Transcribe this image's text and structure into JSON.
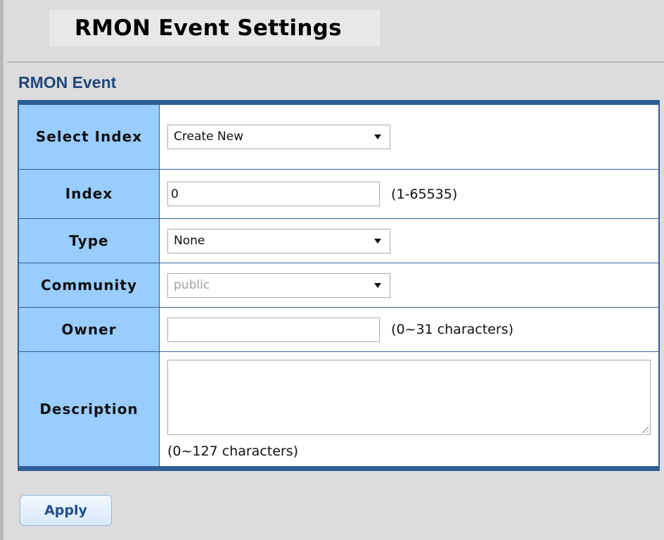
{
  "page": {
    "title": "RMON Event Settings",
    "section_title": "RMON Event"
  },
  "form": {
    "select_index": {
      "label": "Select Index",
      "value": "Create New"
    },
    "index": {
      "label": "Index",
      "value": "0",
      "hint": "(1-65535)"
    },
    "type": {
      "label": "Type",
      "value": "None"
    },
    "community": {
      "label": "Community",
      "value": "public",
      "disabled": true
    },
    "owner": {
      "label": "Owner",
      "value": "",
      "hint": "(0~31 characters)"
    },
    "description": {
      "label": "Description",
      "value": "",
      "hint": "(0~127 characters)"
    }
  },
  "actions": {
    "apply_label": "Apply"
  },
  "colors": {
    "label_bg": "#99ccff",
    "border": "#2e5f97",
    "section_title": "#1f477a",
    "apply_text": "#1e4f8a"
  }
}
